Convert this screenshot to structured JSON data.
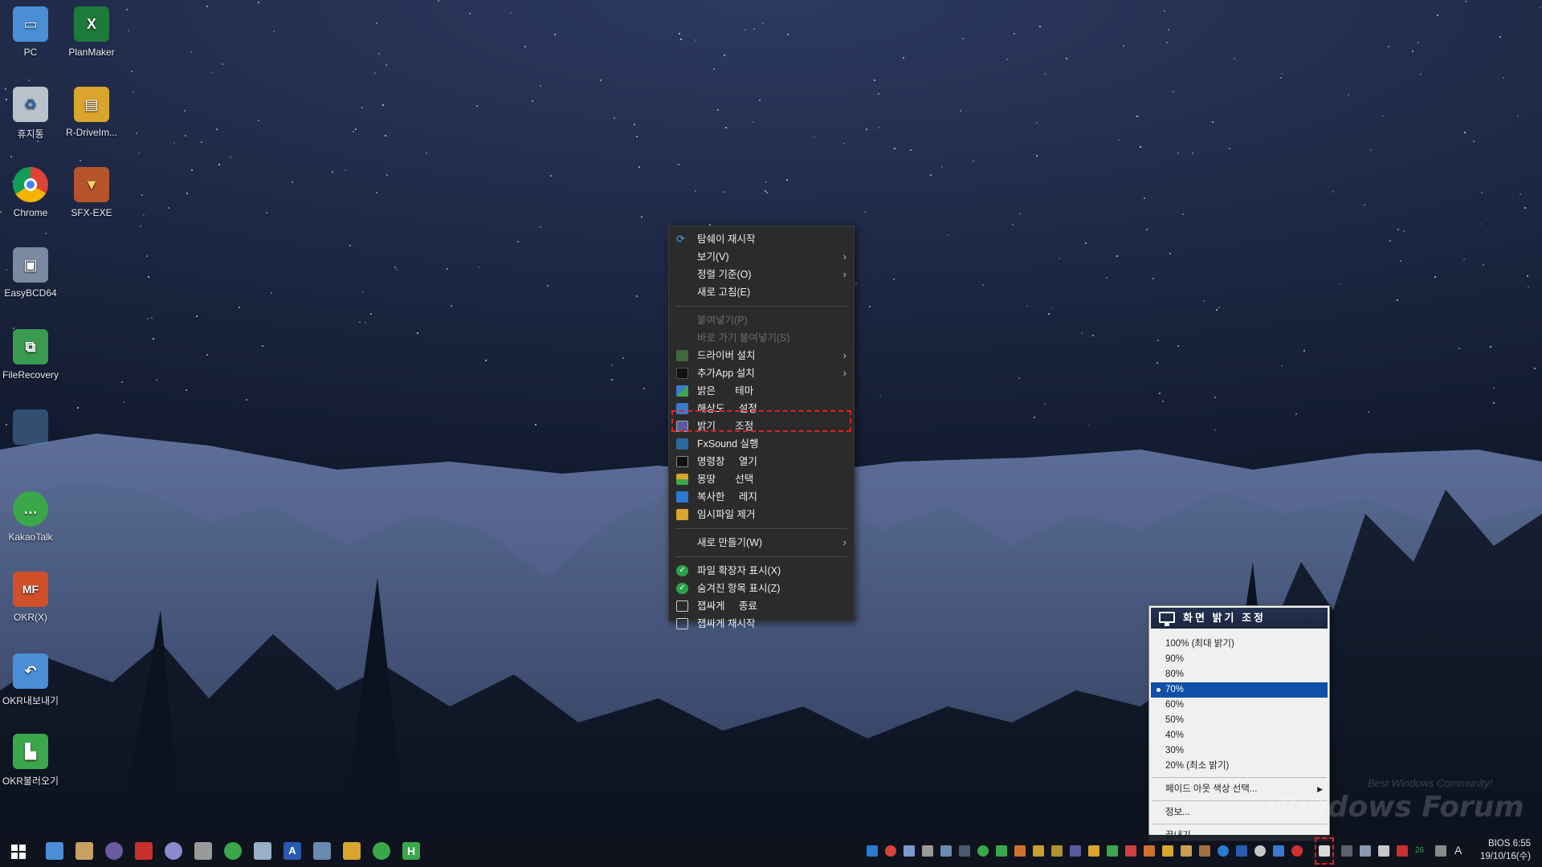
{
  "desktop": {
    "icons": [
      {
        "label": "PC",
        "color": "#4a8fd6"
      },
      {
        "label": "PlanMaker",
        "color": "#1e7a3a"
      },
      {
        "label": "휴지통",
        "color": "#b9c3cc"
      },
      {
        "label": "R-DriveIm...",
        "color": "#d9a52c"
      },
      {
        "label": "Chrome",
        "color": "#db4437"
      },
      {
        "label": "SFX-EXE",
        "color": "#b5542a"
      },
      {
        "label": "EasyBCD64",
        "color": "#7a8aa0"
      },
      {
        "label": "FileRecovery",
        "color": "#3a9a50"
      },
      {
        "label": "KakaoTalk",
        "color": "#3aa84a"
      },
      {
        "label": "OKR(X)",
        "color": "#d0502a"
      },
      {
        "label": "OKR내보내기",
        "color": "#3aa84a"
      },
      {
        "label": "OKR불러오기",
        "color": "#3aa84a"
      }
    ]
  },
  "context_menu": {
    "items": [
      {
        "label": "탐쉐이 재시작",
        "icon": "refresh-icon"
      },
      {
        "label": "보기(V)",
        "submenu": true
      },
      {
        "label": "정렬 기준(O)",
        "submenu": true
      },
      {
        "label": "새로 고침(E)"
      },
      {
        "label": "붙여넣기(P)",
        "disabled": true
      },
      {
        "label": "바로 가기 붙여넣기(S)",
        "disabled": true
      },
      {
        "label": "드라이버 설치",
        "submenu": true,
        "icon": "driver-icon"
      },
      {
        "label": "추가App 설치",
        "submenu": true,
        "icon": "app-icon"
      },
      {
        "label": "밝은       테마",
        "icon": "theme-icon"
      },
      {
        "label": "해상도     설정",
        "icon": "resolution-icon"
      },
      {
        "label": "밝기       조정",
        "icon": "brightness-icon"
      },
      {
        "label": "FxSound 실행",
        "icon": "fxsound-icon"
      },
      {
        "label": "명령창     열기",
        "icon": "cmd-icon"
      },
      {
        "label": "몽땅       선택",
        "icon": "select-all-icon"
      },
      {
        "label": "복사한     레지",
        "icon": "registry-icon"
      },
      {
        "label": "임시파일 제거",
        "icon": "cleanup-icon"
      },
      {
        "label": "새로 만들기(W)",
        "submenu": true
      },
      {
        "label": "파일 확장자 표시(X)",
        "icon": "check-icon"
      },
      {
        "label": "숨겨진 항목 표시(Z)",
        "icon": "check-icon"
      },
      {
        "label": "잽싸게     종료",
        "icon": "exit-icon"
      },
      {
        "label": "잽싸게 재시작",
        "icon": "restart-icon"
      }
    ]
  },
  "brightness_popup": {
    "title": "화면 밝기 조정",
    "levels": [
      "100% (최대 밝기)",
      "90%",
      "80%",
      "70%",
      "60%",
      "50%",
      "40%",
      "30%",
      "20% (최소 밝기)"
    ],
    "selected": "70%",
    "fade_label": "페이드 아웃 색상 선택...",
    "info_label": "정보...",
    "exit_label": "끝내기"
  },
  "taskbar": {
    "tray_text": [
      "A"
    ],
    "tray_badge": "26",
    "clock_top": "BIOS  6:55",
    "clock_bottom": "19/10/16(수)"
  },
  "watermark": {
    "main": "Windows Forum",
    "sub": "Best Windows Community!"
  }
}
